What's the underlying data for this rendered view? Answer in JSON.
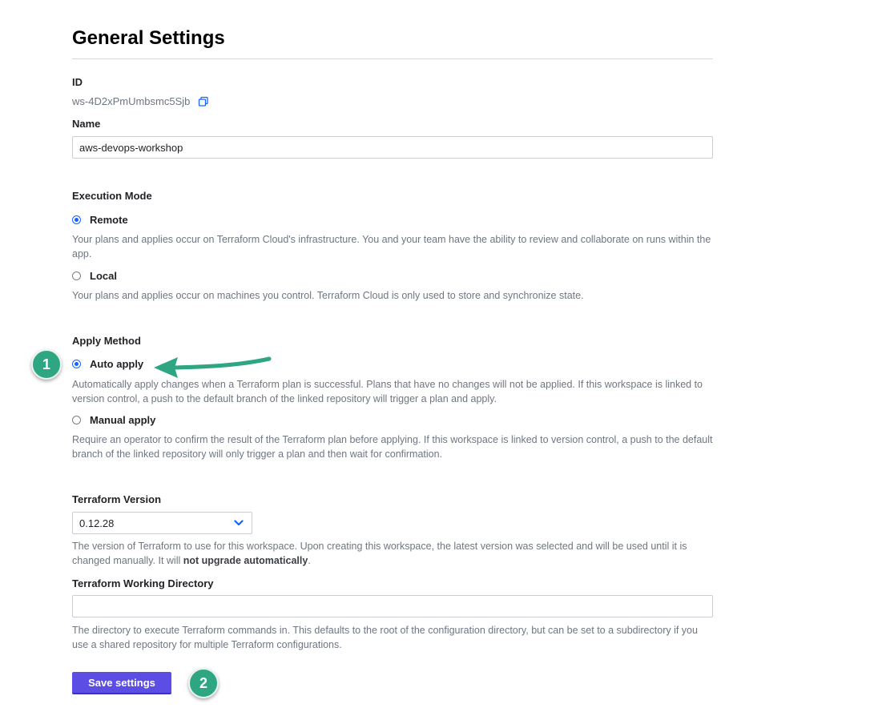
{
  "page": {
    "title": "General Settings"
  },
  "id_field": {
    "label": "ID",
    "value": "ws-4D2xPmUmbsmc5Sjb",
    "copy_icon": "copy-icon"
  },
  "name_field": {
    "label": "Name",
    "value": "aws-devops-workshop"
  },
  "execution_mode": {
    "label": "Execution Mode",
    "options": [
      {
        "label": "Remote",
        "checked": true,
        "description": "Your plans and applies occur on Terraform Cloud's infrastructure. You and your team have the ability to review and collaborate on runs within the app."
      },
      {
        "label": "Local",
        "checked": false,
        "description": "Your plans and applies occur on machines you control. Terraform Cloud is only used to store and synchronize state."
      }
    ]
  },
  "apply_method": {
    "label": "Apply Method",
    "options": [
      {
        "label": "Auto apply",
        "checked": true,
        "description": "Automatically apply changes when a Terraform plan is successful. Plans that have no changes will not be applied. If this workspace is linked to version control, a push to the default branch of the linked repository will trigger a plan and apply."
      },
      {
        "label": "Manual apply",
        "checked": false,
        "description": "Require an operator to confirm the result of the Terraform plan before applying. If this workspace is linked to version control, a push to the default branch of the linked repository will only trigger a plan and then wait for confirmation."
      }
    ]
  },
  "terraform_version": {
    "label": "Terraform Version",
    "selected": "0.12.28",
    "help_prefix": "The version of Terraform to use for this workspace. Upon creating this workspace, the latest version was selected and will be used until it is changed manually. It will ",
    "help_bold": "not upgrade automatically",
    "help_suffix": "."
  },
  "working_directory": {
    "label": "Terraform Working Directory",
    "value": "",
    "help": "The directory to execute Terraform commands in. This defaults to the root of the configuration directory, but can be set to a subdirectory if you use a shared repository for multiple Terraform configurations."
  },
  "save_button": {
    "label": "Save settings"
  },
  "callouts": {
    "one": "1",
    "two": "2"
  },
  "colors": {
    "accent": "#5c4ee5",
    "radio": "#1563ff",
    "callout": "#2fa682"
  }
}
